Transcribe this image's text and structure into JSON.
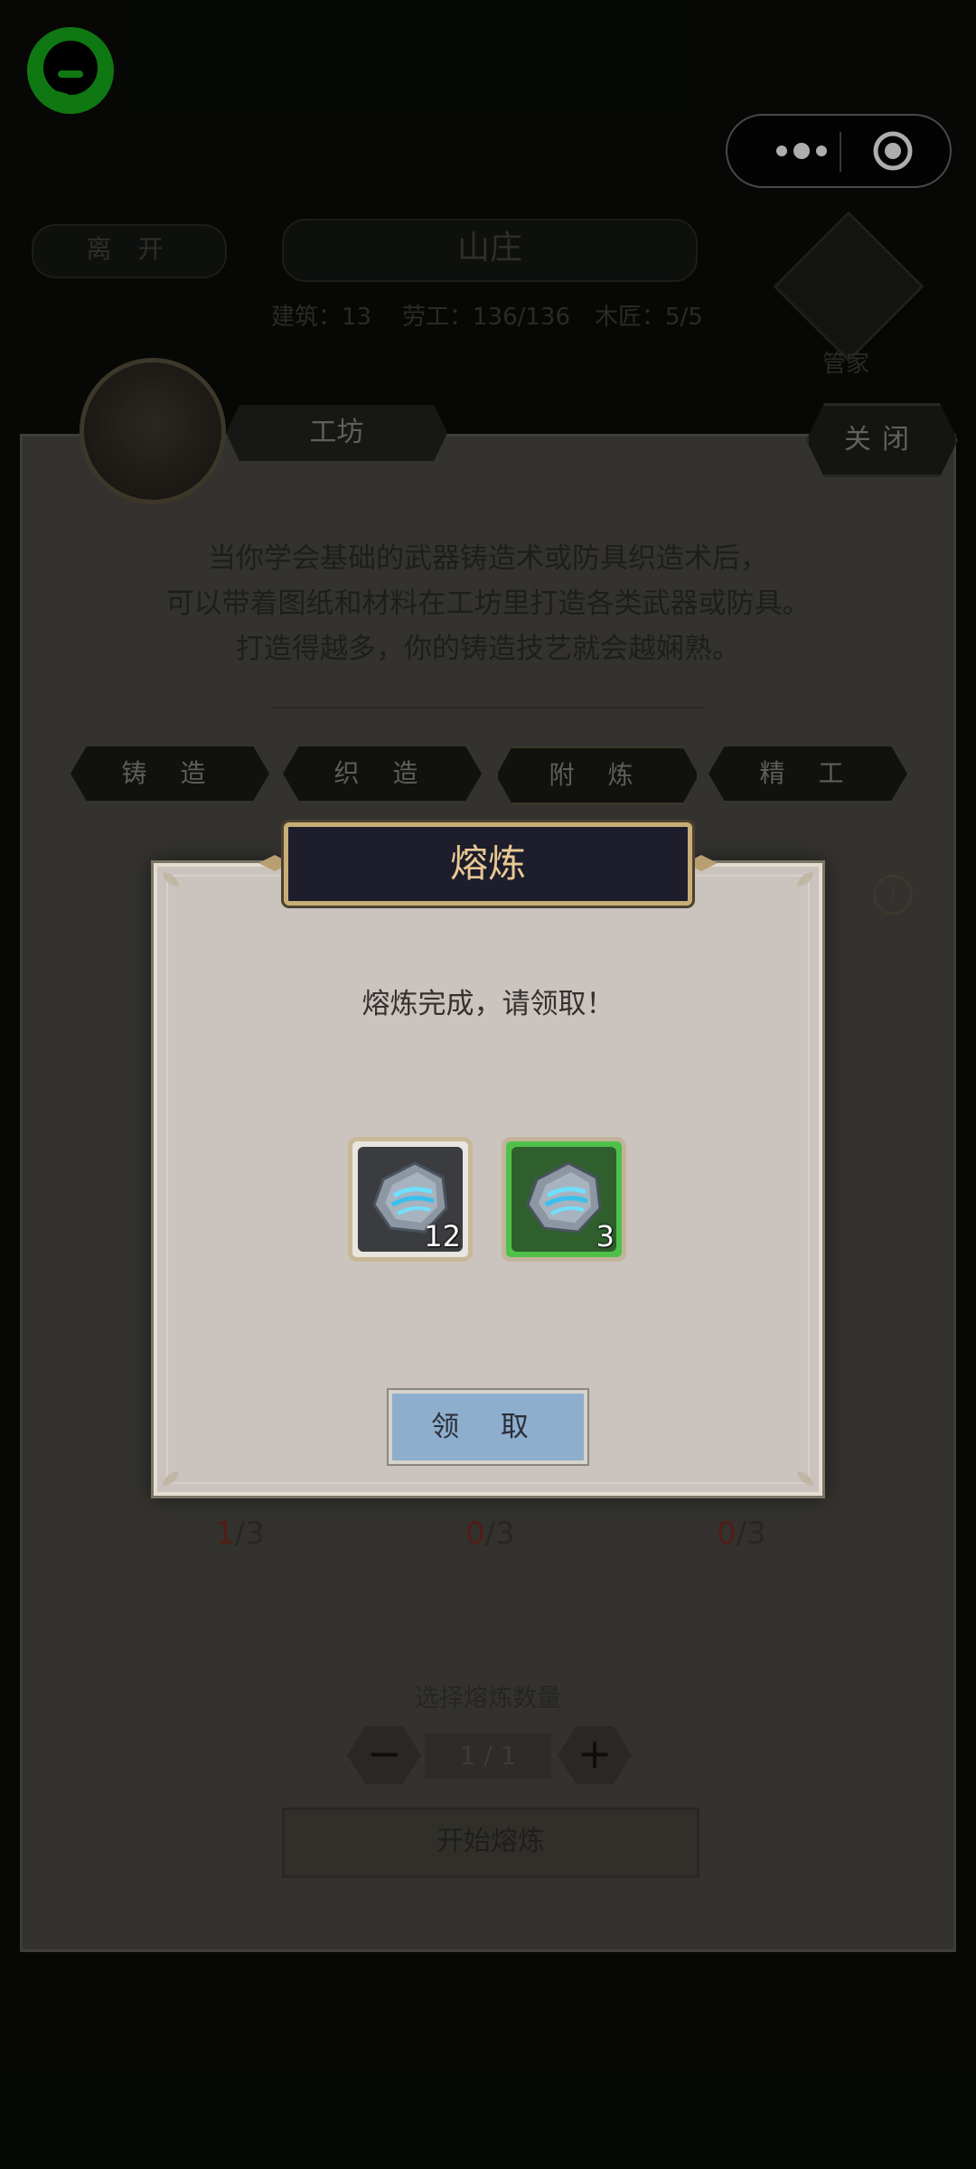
{
  "top_bar": {
    "logo_icon": "chat-bubble-icon",
    "capsule": {
      "menu_icon": "more-dots-icon",
      "close_icon": "target-circle-icon"
    }
  },
  "background": {
    "leave_label": "离 开",
    "manor_title": "山庄",
    "stats": {
      "buildings": "建筑：13",
      "workers": "劳工：136/136",
      "craftsmen": "木匠：5/5"
    },
    "steward_label": "管家",
    "workshop": {
      "title": "工坊",
      "close_label": "关闭",
      "intro_lines": [
        "当你学会基础的武器铸造术或防具织造术后，",
        "可以带着图纸和材料在工坊里打造各类武器或防具。",
        "打造得越多，你的铸造技艺就会越娴熟。"
      ],
      "tabs": [
        "铸 造",
        "织 造",
        "附 炼",
        "精 工"
      ],
      "counts": [
        {
          "left": "1",
          "right": "/3"
        },
        {
          "left": "0",
          "right": "/3"
        },
        {
          "left": "0",
          "right": "/3"
        }
      ],
      "quantity_label": "选择熔炼数量",
      "quantity_value": "1 / 1",
      "start_label": "开始熔炼"
    }
  },
  "dialog": {
    "title": "熔炼",
    "message": "熔炼完成，请领取！",
    "items": [
      {
        "name": "ore-item",
        "count": "12",
        "rarity_color": "#e9e5df"
      },
      {
        "name": "ore-item",
        "count": "3",
        "rarity_color": "#4fc14b"
      }
    ],
    "claim_label": "领 取"
  }
}
